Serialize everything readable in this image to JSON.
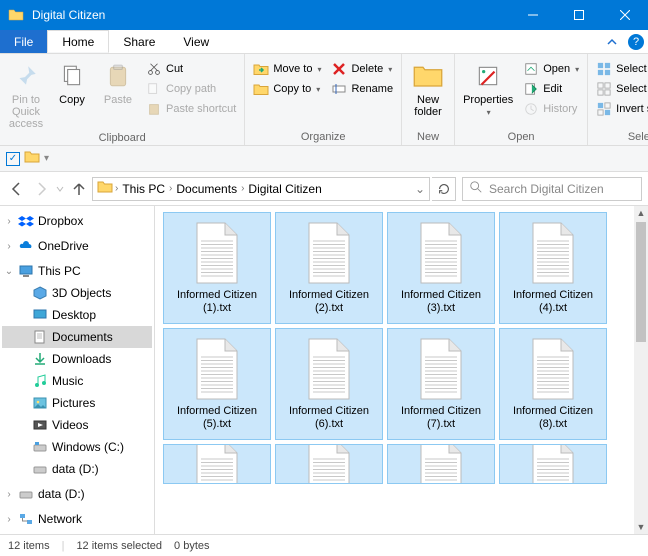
{
  "window": {
    "title": "Digital Citizen"
  },
  "menu": {
    "file": "File"
  },
  "tabs": {
    "home": "Home",
    "share": "Share",
    "view": "View"
  },
  "ribbon": {
    "clipboard": {
      "pin": "Pin to Quick\naccess",
      "copy": "Copy",
      "paste": "Paste",
      "cut": "Cut",
      "copypath": "Copy path",
      "pasteshortcut": "Paste shortcut",
      "caption": "Clipboard"
    },
    "organize": {
      "moveto": "Move to",
      "copyto": "Copy to",
      "delete": "Delete",
      "rename": "Rename",
      "caption": "Organize"
    },
    "new": {
      "newfolder": "New\nfolder",
      "caption": "New"
    },
    "open": {
      "properties": "Properties",
      "open": "Open",
      "edit": "Edit",
      "history": "History",
      "caption": "Open"
    },
    "select": {
      "selectall": "Select all",
      "selectnone": "Select none",
      "invert": "Invert selection",
      "caption": "Select"
    }
  },
  "breadcrumbs": {
    "thispc": "This PC",
    "documents": "Documents",
    "current": "Digital Citizen"
  },
  "search": {
    "placeholder": "Search Digital Citizen"
  },
  "sidebar": {
    "dropbox": "Dropbox",
    "onedrive": "OneDrive",
    "thispc": "This PC",
    "objects3d": "3D Objects",
    "desktop": "Desktop",
    "documents": "Documents",
    "downloads": "Downloads",
    "music": "Music",
    "pictures": "Pictures",
    "videos": "Videos",
    "windowsc": "Windows (C:)",
    "datad1": "data (D:)",
    "datad2": "data (D:)",
    "network": "Network"
  },
  "files": [
    {
      "name": "Informed Citizen (1).txt"
    },
    {
      "name": "Informed Citizen (2).txt"
    },
    {
      "name": "Informed Citizen (3).txt"
    },
    {
      "name": "Informed Citizen (4).txt"
    },
    {
      "name": "Informed Citizen (5).txt"
    },
    {
      "name": "Informed Citizen (6).txt"
    },
    {
      "name": "Informed Citizen (7).txt"
    },
    {
      "name": "Informed Citizen (8).txt"
    }
  ],
  "status": {
    "itemcount": "12 items",
    "selected": "12 items selected",
    "size": "0 bytes"
  }
}
